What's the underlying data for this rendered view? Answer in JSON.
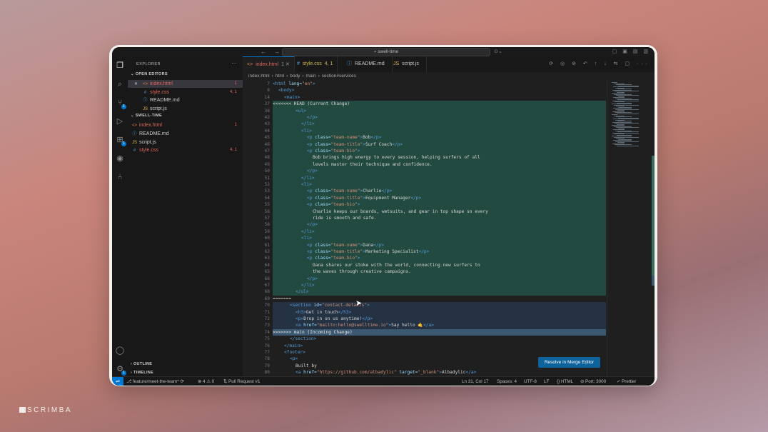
{
  "titlebar": {
    "back": "←",
    "forward": "→",
    "search_text": "⌕ swell-time",
    "copilot": "⊙⌄",
    "layout_icons": "▢ ▣ ▤ ▥"
  },
  "activity": [
    "files-icon",
    "search-icon",
    "source-control-icon",
    "run-debug-icon",
    "extensions-icon",
    "github-icon",
    "remote-icon",
    "account-icon",
    "settings-icon"
  ],
  "sidebar": {
    "title": "EXPLORER",
    "more": "···",
    "open_editors_label": "OPEN EDITORS",
    "open_editors": [
      {
        "close": "✕",
        "icon": "<>",
        "name": "index.html",
        "count": "1"
      },
      {
        "close": "",
        "icon": "#",
        "name": "style.css",
        "count": "4, 1"
      },
      {
        "close": "",
        "icon": "ⓘ",
        "name": "README.md",
        "count": ""
      },
      {
        "close": "",
        "icon": "JS",
        "name": "script.js",
        "count": ""
      }
    ],
    "workspace_label": "SWELL-TIME",
    "files": [
      {
        "icon": "<>",
        "name": "index.html",
        "count": "1"
      },
      {
        "icon": "ⓘ",
        "name": "README.md",
        "count": ""
      },
      {
        "icon": "JS",
        "name": "script.js",
        "count": ""
      },
      {
        "icon": "#",
        "name": "style.css",
        "count": "4, 1"
      }
    ],
    "outline_label": "OUTLINE",
    "timeline_label": "TIMELINE"
  },
  "tabs": [
    {
      "icon": "<>",
      "label": "index.html",
      "extra": "1  ✕"
    },
    {
      "icon": "#",
      "label": "style.css",
      "extra": "4, 1"
    },
    {
      "icon": "ⓘ",
      "label": "README.md",
      "extra": ""
    },
    {
      "icon": "JS",
      "label": "script.js",
      "extra": ""
    }
  ],
  "tab_actions": "⟳ ◎ ⊘ ↶ ↑ ↓ ⇆ ▢ ···",
  "breadcrumb": [
    "index.html",
    "html",
    "body",
    "main",
    "section#services"
  ],
  "code_lines": [
    {
      "n": "7",
      "t": "<html lang=\"en\">",
      "i": 0
    },
    {
      "n": "8",
      "t": "<body>",
      "i": 1
    },
    {
      "n": "14",
      "t": "<main>",
      "i": 2
    },
    {
      "n": "37",
      "t": "<<<<<<< HEAD (Current Change)",
      "i": 0,
      "type": "hdr-current"
    },
    {
      "n": "38",
      "t": "<ul>",
      "i": 4
    },
    {
      "n": "42",
      "t": "</p>",
      "i": 6
    },
    {
      "n": "43",
      "t": "</li>",
      "i": 5
    },
    {
      "n": "44",
      "t": "<li>",
      "i": 5
    },
    {
      "n": "45",
      "t": "<p class=\"team-name\">Bob</p>",
      "i": 6
    },
    {
      "n": "46",
      "t": "<p class=\"team-title\">Surf Coach</p>",
      "i": 6
    },
    {
      "n": "47",
      "t": "<p class=\"team-bio\">",
      "i": 6
    },
    {
      "n": "48",
      "t": "Bob brings high energy to every session, helping surfers of all",
      "i": 7
    },
    {
      "n": "49",
      "t": "levels master their technique and confidence.",
      "i": 7
    },
    {
      "n": "50",
      "t": "</p>",
      "i": 6
    },
    {
      "n": "51",
      "t": "</li>",
      "i": 5
    },
    {
      "n": "52",
      "t": "<li>",
      "i": 5
    },
    {
      "n": "53",
      "t": "<p class=\"team-name\">Charlie</p>",
      "i": 6
    },
    {
      "n": "54",
      "t": "<p class=\"team-title\">Equipment Manager</p>",
      "i": 6
    },
    {
      "n": "55",
      "t": "<p class=\"team-bio\">",
      "i": 6
    },
    {
      "n": "56",
      "t": "Charlie keeps our boards, wetsuits, and gear in top shape so every",
      "i": 7
    },
    {
      "n": "57",
      "t": "ride is smooth and safe.",
      "i": 7
    },
    {
      "n": "58",
      "t": "</p>",
      "i": 6
    },
    {
      "n": "59",
      "t": "</li>",
      "i": 5
    },
    {
      "n": "60",
      "t": "<li>",
      "i": 5
    },
    {
      "n": "61",
      "t": "<p class=\"team-name\">Dana</p>",
      "i": 6
    },
    {
      "n": "62",
      "t": "<p class=\"team-title\">Marketing Specialist</p>",
      "i": 6
    },
    {
      "n": "63",
      "t": "<p class=\"team-bio\">",
      "i": 6
    },
    {
      "n": "64",
      "t": "Dana shares our stoke with the world, connecting new surfers to",
      "i": 7
    },
    {
      "n": "65",
      "t": "the waves through creative campaigns.",
      "i": 7
    },
    {
      "n": "66",
      "t": "</p>",
      "i": 6
    },
    {
      "n": "67",
      "t": "</li>",
      "i": 5
    },
    {
      "n": "68",
      "t": "</ul>",
      "i": 4
    },
    {
      "n": "69",
      "t": "=======",
      "i": 0,
      "type": "sep"
    },
    {
      "n": "70",
      "t": "<section id=\"contact-details\">",
      "i": 3
    },
    {
      "n": "71",
      "t": "<h3>Get in touch</h3>",
      "i": 4
    },
    {
      "n": "72",
      "t": "<p>Drop in on us anytime!</p>",
      "i": 4
    },
    {
      "n": "73",
      "t": "<a href=\"mailto:hello@swelltime.io\">Say hello 🤙</a>",
      "i": 4
    },
    {
      "n": "74",
      "t": ">>>>>>> main (Incoming Change)",
      "i": 0,
      "type": "hdr-incoming"
    },
    {
      "n": "75",
      "t": "</section>",
      "i": 3
    },
    {
      "n": "76",
      "t": "</main>",
      "i": 2
    },
    {
      "n": "77",
      "t": "<footer>",
      "i": 2
    },
    {
      "n": "78",
      "t": "<p>",
      "i": 3
    },
    {
      "n": "79",
      "t": "Built by",
      "i": 4
    },
    {
      "n": "80",
      "t": "<a href=\"https://github.com/albadylic\" target=\"_blank\">Albadylic</a>",
      "i": 4
    }
  ],
  "resolve_button": "Resolve in Merge Editor",
  "status": {
    "remote": "⇌",
    "branch": "⎇ feature/meet-the-team* ⟳",
    "problems": "⊗ 4  ⚠ 0",
    "pull_request": "⇅ Pull Request #1",
    "position": "Ln 31, Col 17",
    "spaces": "Spaces: 4",
    "encoding": "UTF-8",
    "eol": "LF",
    "lang": "{} HTML",
    "port": "⊘ Port: 3000",
    "prettier": "✓ Prettier"
  },
  "brand": "SCRIMBA"
}
